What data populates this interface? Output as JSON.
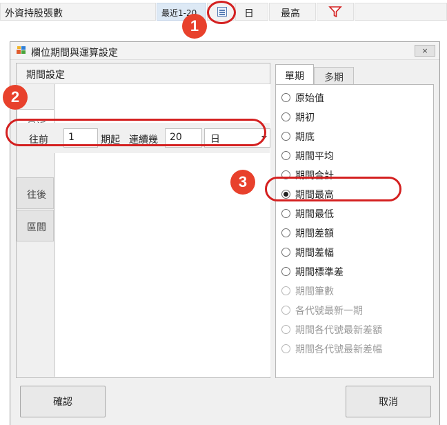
{
  "top_bar": {
    "title": "外資持股張數",
    "range_text": "最近1-20",
    "frequency": "日",
    "mode": "最高",
    "edit_icon": "edit-icon",
    "filter_icon": "filter-icon",
    "filter_color": "#d42020"
  },
  "dialog": {
    "title": "欄位期間與運算設定",
    "close_label": "×",
    "left_panel": {
      "header": "期間設定",
      "vtabs": [
        "最近",
        "往後",
        "區間"
      ],
      "row": {
        "forward_label": "往前",
        "n_value": "1",
        "start_label": "期起",
        "consecutive_label": "連續幾",
        "count_value": "20",
        "unit_value": "日"
      }
    },
    "right_panel": {
      "tabs": [
        "單期",
        "多期"
      ],
      "options": [
        {
          "label": "原始值",
          "checked": false,
          "enabled": true
        },
        {
          "label": "期初",
          "checked": false,
          "enabled": true
        },
        {
          "label": "期底",
          "checked": false,
          "enabled": true
        },
        {
          "label": "期間平均",
          "checked": false,
          "enabled": true
        },
        {
          "label": "期間合計",
          "checked": false,
          "enabled": true
        },
        {
          "label": "期間最高",
          "checked": true,
          "enabled": true
        },
        {
          "label": "期間最低",
          "checked": false,
          "enabled": true
        },
        {
          "label": "期間差額",
          "checked": false,
          "enabled": true
        },
        {
          "label": "期間差幅",
          "checked": false,
          "enabled": true
        },
        {
          "label": "期間標準差",
          "checked": false,
          "enabled": true
        },
        {
          "label": "期間筆數",
          "checked": false,
          "enabled": false
        },
        {
          "label": "各代號最新一期",
          "checked": false,
          "enabled": false
        },
        {
          "label": "期間各代號最新差額",
          "checked": false,
          "enabled": false
        },
        {
          "label": "期間各代號最新差幅",
          "checked": false,
          "enabled": false
        }
      ]
    },
    "confirm_label": "確認",
    "cancel_label": "取消"
  },
  "annotations": {
    "callout_1": "1",
    "callout_2": "2",
    "callout_3": "3",
    "color": "#e8412c"
  }
}
